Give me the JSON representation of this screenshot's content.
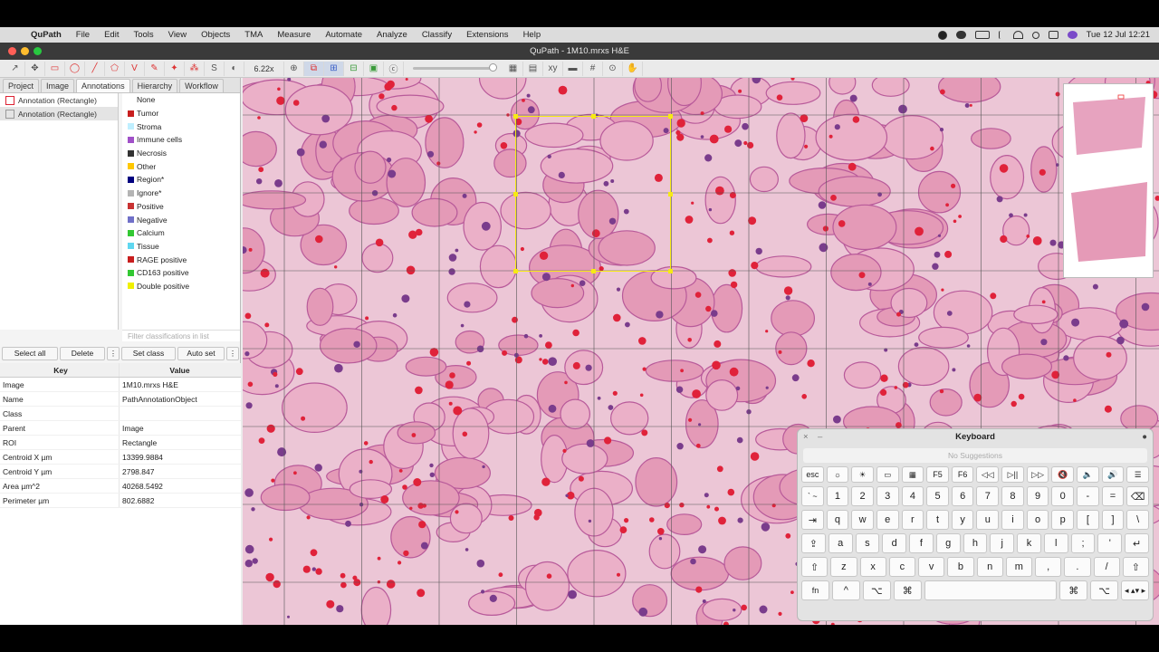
{
  "menubar": {
    "app_name": "QuPath",
    "items": [
      "File",
      "Edit",
      "Tools",
      "View",
      "Objects",
      "TMA",
      "Measure",
      "Automate",
      "Analyze",
      "Classify",
      "Extensions",
      "Help"
    ],
    "datetime": "Tue 12 Jul  12:21"
  },
  "window": {
    "title": "QuPath - 1M10.mrxs H&E"
  },
  "toolbar": {
    "zoom": "6.22x",
    "s_label": "S"
  },
  "tabs": [
    "Project",
    "Image",
    "Annotations",
    "Hierarchy",
    "Workflow"
  ],
  "annotations": [
    {
      "label": "Annotation (Rectangle)"
    },
    {
      "label": "Annotation (Rectangle)"
    }
  ],
  "classes": [
    {
      "label": "None",
      "color": "#ffffff"
    },
    {
      "label": "Tumor",
      "color": "#c81e1e"
    },
    {
      "label": "Stroma",
      "color": "#bfefff"
    },
    {
      "label": "Immune cells",
      "color": "#a050c8"
    },
    {
      "label": "Necrosis",
      "color": "#323232"
    },
    {
      "label": "Other",
      "color": "#ffc800"
    },
    {
      "label": "Region*",
      "color": "#00007f"
    },
    {
      "label": "Ignore*",
      "color": "#b4b4b4"
    },
    {
      "label": "Positive",
      "color": "#c83232"
    },
    {
      "label": "Negative",
      "color": "#7070c8"
    },
    {
      "label": "Calcium",
      "color": "#32c832"
    },
    {
      "label": "Tissue",
      "color": "#5fd7f0"
    },
    {
      "label": "RAGE positive",
      "color": "#c81e1e"
    },
    {
      "label": "CD163 positive",
      "color": "#32c832"
    },
    {
      "label": "Double positive",
      "color": "#f0f000"
    }
  ],
  "filter_placeholder": "Filter classifications in list",
  "buttons": {
    "select_all": "Select all",
    "delete": "Delete",
    "set_class": "Set class",
    "auto_set": "Auto set",
    "more": "⋮"
  },
  "properties": {
    "header_key": "Key",
    "header_value": "Value",
    "rows": [
      {
        "key": "Image",
        "value": "1M10.mrxs H&E"
      },
      {
        "key": "Name",
        "value": "PathAnnotationObject"
      },
      {
        "key": "Class",
        "value": ""
      },
      {
        "key": "Parent",
        "value": "Image"
      },
      {
        "key": "ROI",
        "value": "Rectangle"
      },
      {
        "key": "Centroid X µm",
        "value": "13399.9884"
      },
      {
        "key": "Centroid Y µm",
        "value": "2798.847"
      },
      {
        "key": "Area µm^2",
        "value": "40268.5492"
      },
      {
        "key": "Perimeter µm",
        "value": "802.6882"
      }
    ]
  },
  "keyboard": {
    "title": "Keyboard",
    "suggestions": "No Suggestions",
    "row_fn": [
      "esc",
      "☼",
      "☀",
      "▭",
      "▦",
      "F5",
      "F6",
      "◁◁",
      "▷||",
      "▷▷",
      "🔇",
      "🔈",
      "🔊",
      "☰"
    ],
    "row_num": [
      "` ~",
      "1",
      "2",
      "3",
      "4",
      "5",
      "6",
      "7",
      "8",
      "9",
      "0",
      "-",
      "=",
      "⌫"
    ],
    "row_q": [
      "⇥",
      "q",
      "w",
      "e",
      "r",
      "t",
      "y",
      "u",
      "i",
      "o",
      "p",
      "[",
      "]",
      "\\"
    ],
    "row_a": [
      "⇪",
      "a",
      "s",
      "d",
      "f",
      "g",
      "h",
      "j",
      "k",
      "l",
      ";",
      "'",
      "↵"
    ],
    "row_z": [
      "⇧",
      "z",
      "x",
      "c",
      "v",
      "b",
      "n",
      "m",
      ",",
      ".",
      "/",
      "⇧"
    ],
    "row_bottom": [
      "fn",
      "^",
      "⌥",
      "⌘",
      "",
      "⌘",
      "⌥",
      "◂ ▴▾ ▸"
    ]
  },
  "colors": {
    "selection": "#f6ea14",
    "tissue_bg": "#ecc6d6"
  }
}
